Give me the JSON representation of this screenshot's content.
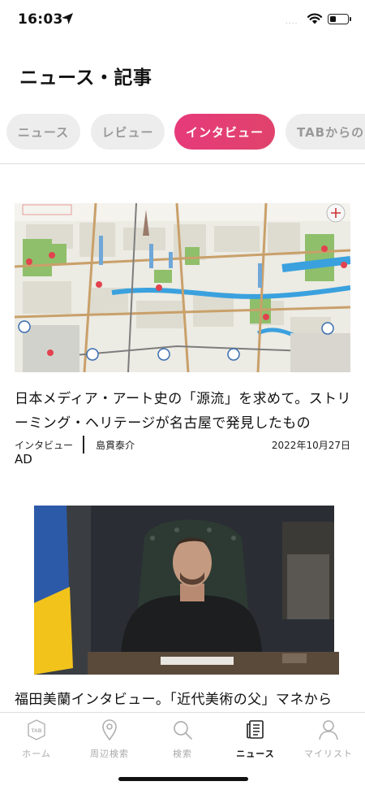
{
  "status_bar": {
    "time": "16:03",
    "signal_text": "....",
    "battery_level": 0.35,
    "icons": [
      "location-arrow-icon",
      "wifi-icon",
      "battery-icon"
    ]
  },
  "header": {
    "title": "ニュース・記事"
  },
  "tabs": [
    {
      "label": "ニュース",
      "active": false
    },
    {
      "label": "レビュー",
      "active": false
    },
    {
      "label": "インタビュー",
      "active": true
    },
    {
      "label": "TABからの",
      "active": false
    }
  ],
  "colors": {
    "accent": "#e63a7a",
    "tab_inactive_bg": "#ededed",
    "tab_inactive_text": "#9a9a9a"
  },
  "articles": [
    {
      "title": "日本メディア・アート史の「源流」を求めて。ストリーミング・ヘリテージが名古屋で発見したもの",
      "category": "インタビュー",
      "author": "島貫泰介",
      "date": "2022年10月27日",
      "badge": "AD",
      "image_desc": "illustrated-city-map"
    },
    {
      "title": "福田美蘭インタビュー。「近代美術の父」マネから",
      "image_desc": "man-at-desk-photo"
    }
  ],
  "bottom_nav": [
    {
      "label": "ホーム",
      "icon": "tab-logo-icon",
      "active": false
    },
    {
      "label": "周辺検索",
      "icon": "map-pin-icon",
      "active": false
    },
    {
      "label": "検索",
      "icon": "search-icon",
      "active": false
    },
    {
      "label": "ニュース",
      "icon": "news-icon",
      "active": true
    },
    {
      "label": "マイリスト",
      "icon": "person-icon",
      "active": false
    }
  ]
}
